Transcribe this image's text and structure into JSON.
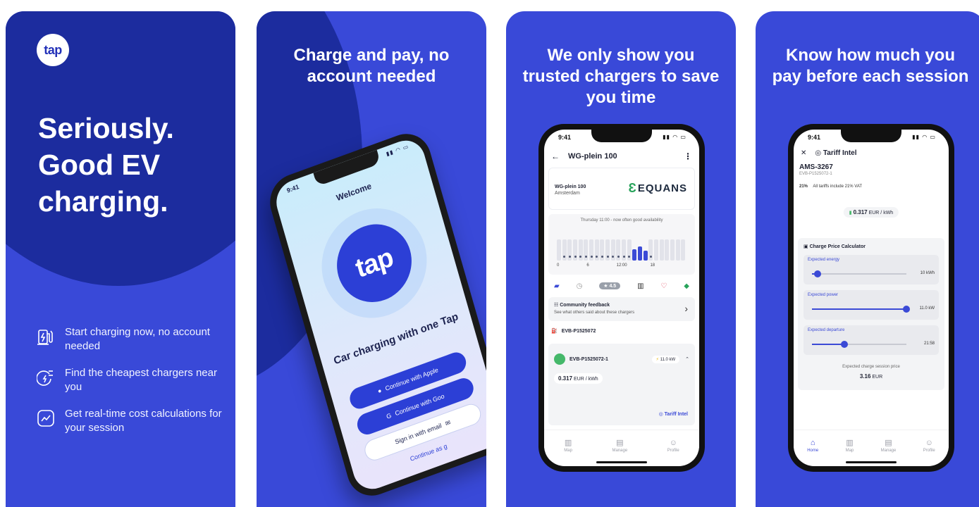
{
  "panel1": {
    "logo_text": "tap",
    "hero_lines": [
      "Seriously.",
      "Good EV",
      "charging."
    ],
    "features": [
      {
        "icon": "charging-station-icon",
        "text": "Start charging now, no account needed"
      },
      {
        "icon": "euro-plug-icon",
        "text": "Find the cheapest chargers near you"
      },
      {
        "icon": "trend-chart-icon",
        "text": "Get real-time cost calculations for your session"
      }
    ]
  },
  "panel2": {
    "headline": "Charge and pay, no account needed",
    "status_time": "9:41",
    "welcome": "Welcome",
    "logo_text": "tap",
    "tagline": "Car charging with one Tap",
    "btn_apple": "Continue with Apple",
    "btn_google": "Continue with Goo",
    "btn_email": "Sign in with email",
    "guest": "Continue as g"
  },
  "panel3": {
    "headline": "We only show you trusted chargers to save you time",
    "status_time": "9:41",
    "location_title": "WG-plein 100",
    "location_name": "WG-plein 100",
    "location_city": "Amsterdam",
    "brand": "EQUANS",
    "availability_caption": "Thursday 11:00 - now often good availability",
    "x_ticks": [
      "0",
      "6",
      "12:00",
      "18"
    ],
    "rating": "4.5",
    "community_title": "Community feedback",
    "community_sub": "See what others said about these chargers",
    "station_id": "EVB-P1525072",
    "evse_id": "EVB-P1525072-1",
    "evse_power": "11.0 kW",
    "evse_price_value": "0.317",
    "evse_price_unit": "EUR / kWh",
    "tariff_link": "Tariff Intel",
    "tabs": [
      "Map",
      "Manage",
      "Profile"
    ]
  },
  "panel4": {
    "headline": "Know how much you pay before each session",
    "status_time": "9:41",
    "screen_title": "Tariff Intel",
    "ref": "AMS-3267",
    "evse": "EVB-P1525072-1",
    "vat_pct": "21%",
    "vat_text": "All tariffs include 21% VAT",
    "price_value": "0.317",
    "price_unit": "EUR / kWh",
    "calc_title": "Charge Price Calculator",
    "fields": [
      {
        "label": "Expected energy",
        "value": "10 kWh",
        "level": 0.06
      },
      {
        "label": "Expected power",
        "value": "11.0 kW",
        "level": 1.0
      },
      {
        "label": "Expected departure",
        "value": "21:58",
        "level": 0.34
      }
    ],
    "session_label": "Expected charge session price",
    "session_value": "3.16",
    "session_unit": "EUR",
    "tabs": [
      "Home",
      "Map",
      "Manage",
      "Profile"
    ]
  },
  "colors": {
    "panel_blue": "#3949d8",
    "panel_dark_blue": "#1c2c9e",
    "accent": "#3b4ad6",
    "equans_green": "#27a35a"
  }
}
